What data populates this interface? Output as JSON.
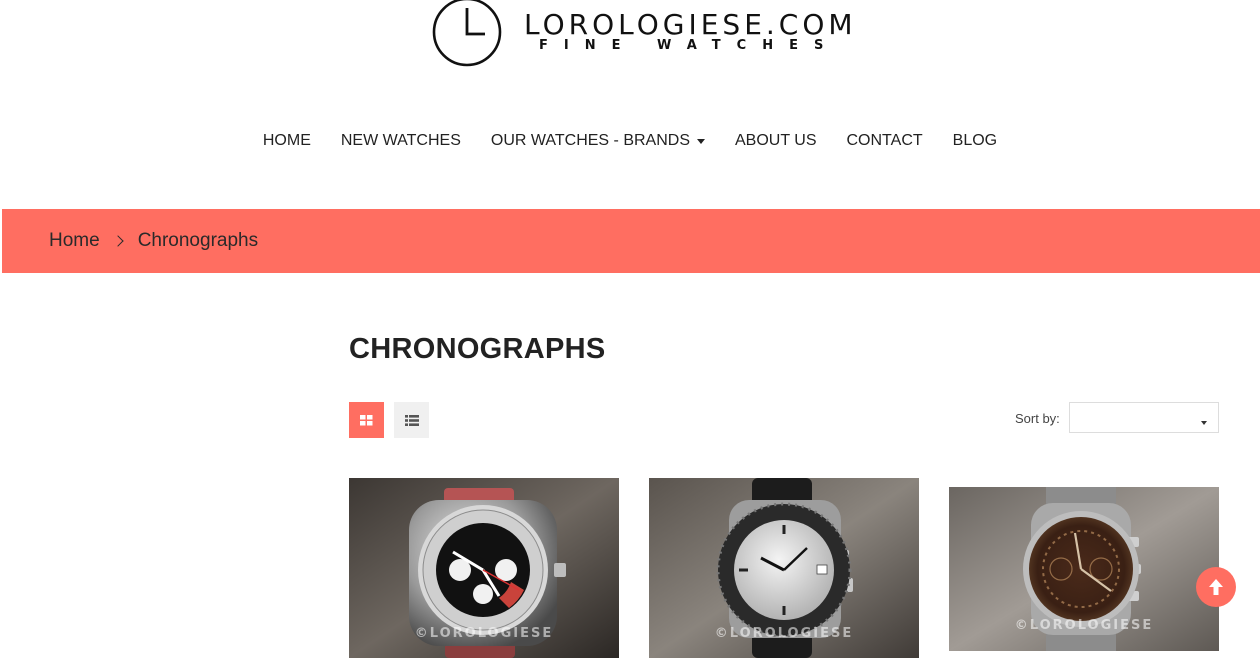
{
  "brand": {
    "name": "LOROLOGIESE.COM",
    "tagline": "FINE WATCHES"
  },
  "nav": {
    "items": [
      {
        "label": "HOME"
      },
      {
        "label": "NEW WATCHES"
      },
      {
        "label": "OUR WATCHES - BRANDS"
      },
      {
        "label": "ABOUT US"
      },
      {
        "label": "CONTACT"
      },
      {
        "label": "BLOG"
      }
    ]
  },
  "breadcrumb": {
    "home": "Home",
    "current": "Chronographs"
  },
  "page": {
    "title": "CHRONOGRAPHS"
  },
  "toolbar": {
    "sort_label": "Sort by:",
    "sort_value": ""
  },
  "products": [
    {
      "watermark": "©LOROLOGIESE"
    },
    {
      "watermark": "©LOROLOGIESE"
    },
    {
      "watermark": "©LOROLOGIESE"
    }
  ],
  "colors": {
    "accent": "#ff6e61",
    "text": "#222222"
  },
  "icons": {
    "grid_view": "grid-icon",
    "list_view": "list-icon",
    "scroll_top": "arrow-up-icon",
    "logo": "clock-icon"
  }
}
